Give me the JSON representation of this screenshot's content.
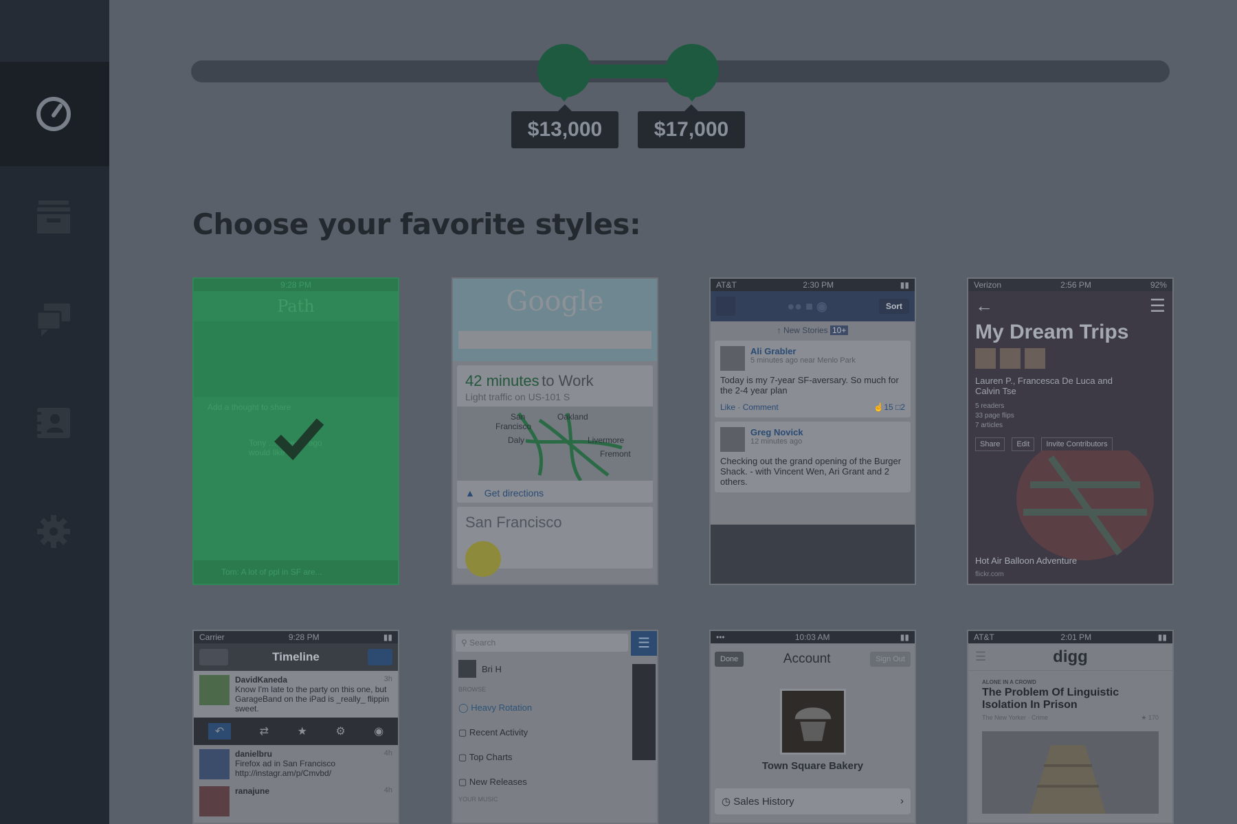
{
  "slider": {
    "min_label": "$13,000",
    "max_label": "$17,000"
  },
  "heading": "Choose your favorite styles:",
  "colors": {
    "accent": "#1e5a3f",
    "selected": "#2f8757",
    "sidebar": "#232932",
    "background": "#5a606a"
  },
  "sidebar": {
    "items": [
      {
        "icon": "gauge-icon"
      },
      {
        "icon": "inbox-icon"
      },
      {
        "icon": "chat-icon"
      },
      {
        "icon": "contact-card-icon"
      },
      {
        "icon": "gear-icon"
      }
    ]
  },
  "styles": [
    {
      "status": "9:28 PM",
      "app_title": "Path",
      "line1": "Add a thought to share",
      "line2": "Tony … 3 years ago would like",
      "line3": "Tom: A lot of ppl in SF are...",
      "selected": true
    },
    {
      "brand": "Google",
      "commute": "42 minutes",
      "commute_suffix": "to Work",
      "traffic": "Light traffic on US-101 S",
      "directions": "Get directions",
      "city": "San Francisco",
      "map_labels": [
        "San",
        "Francisco",
        "Oakland",
        "Daly",
        "Livermore",
        "Fremont"
      ]
    },
    {
      "status_left": "AT&T",
      "status_time": "2:30 PM",
      "sort_label": "Sort",
      "new_stories": "New Stories",
      "new_count": "10+",
      "post1_name": "Ali Grabler",
      "post1_meta": "5 minutes ago near Menlo Park",
      "post1_text": "Today is my 7-year SF-aversary. So much for the 2-4 year plan",
      "like": "Like",
      "comment": "Comment",
      "likes": "15",
      "comments": "2",
      "post2_name": "Greg Novick",
      "post2_meta": "12 minutes ago",
      "post2_text": "Checking out the grand opening of the Burger Shack. - with Vincent Wen, Ari Grant and 2 others."
    },
    {
      "status_left": "Verizon",
      "status_time": "2:56 PM",
      "battery": "92%",
      "title": "My Dream Trips",
      "authors": "Lauren P., Francesca De Luca and Calvin Tse",
      "stats": [
        "5 readers",
        "33 page flips",
        "7 articles"
      ],
      "actions": [
        "Share",
        "Edit",
        "Invite Contributors"
      ],
      "caption": "Hot Air Balloon Adventure",
      "source": "flickr.com"
    },
    {
      "status_left": "Carrier",
      "status_time": "9:28 PM",
      "title": "Timeline",
      "tweet1_user": "DavidKaneda",
      "tweet1_time": "3h",
      "tweet1_text": "Know I'm late to the party on this one, but GarageBand on the iPad is _really_ flippin sweet.",
      "tweet2_user": "danielbru",
      "tweet2_time": "4h",
      "tweet2_text": "Firefox ad in San Francisco http://instagr.am/p/Cmvbd/",
      "tweet3_user": "ranajune",
      "tweet3_time": "4h"
    },
    {
      "search_placeholder": "Search",
      "user": "Bri H",
      "section": "BROWSE",
      "items": [
        "Heavy Rotation",
        "Recent Activity",
        "Top Charts",
        "New Releases"
      ],
      "section2": "YOUR MUSIC"
    },
    {
      "status_time": "10:03 AM",
      "done": "Done",
      "title": "Account",
      "signout": "Sign Out",
      "business": "Town Square Bakery",
      "row": "Sales History"
    },
    {
      "status_left": "AT&T",
      "status_time": "2:01 PM",
      "brand": "digg",
      "kicker": "ALONE IN A CROWD",
      "headline": "The Problem Of Linguistic Isolation In Prison",
      "source": "The New Yorker",
      "section": "Crime",
      "diggs": "170"
    }
  ]
}
